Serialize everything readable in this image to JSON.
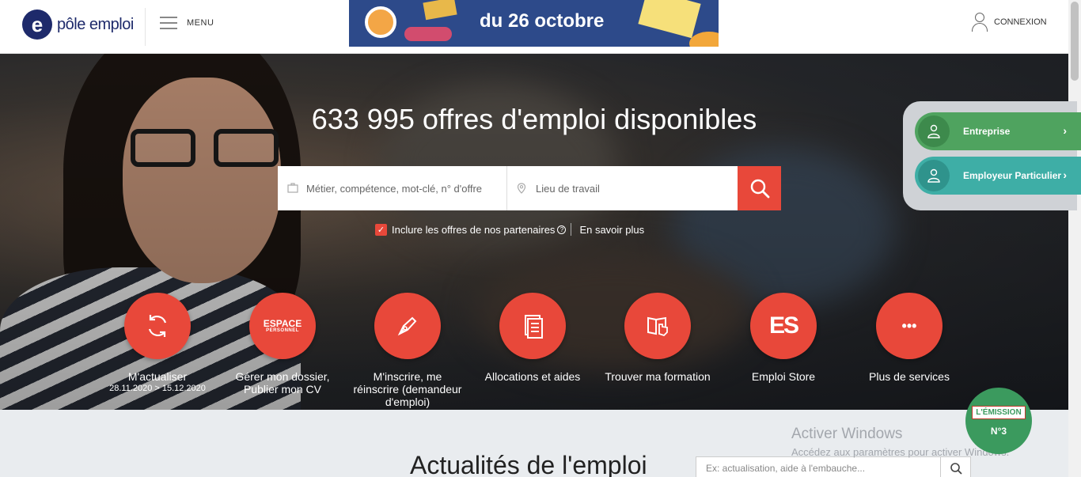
{
  "header": {
    "logo_text": "pôle emploi",
    "logo_mark": "e",
    "menu_label": "MENU",
    "banner_text": "du 26 octobre",
    "connexion_label": "CONNEXION"
  },
  "hero": {
    "title": "633 995 offres d'emploi disponibles",
    "search": {
      "job_placeholder": "Métier, compétence, mot-clé, n° d'offre",
      "location_placeholder": "Lieu de travail"
    },
    "partners_checkbox": {
      "label": "Inclure les offres de nos partenaires",
      "checked": true
    },
    "learn_more": "En savoir plus"
  },
  "services": [
    {
      "label": "M'actualiser",
      "sub": "28.11.2020 > 15.12.2020",
      "icon": "refresh-icon"
    },
    {
      "label": "Gérer mon dossier, Publier mon CV",
      "sub": "",
      "icon": "espace-personnel-icon",
      "icon_text_big": "ESPACE",
      "icon_text_small": "PERSONNEL"
    },
    {
      "label": "M'inscrire, me réinscrire (demandeur d'emploi)",
      "sub": "",
      "icon": "pen-icon"
    },
    {
      "label": "Allocations et aides",
      "sub": "",
      "icon": "document-icon"
    },
    {
      "label": "Trouver ma formation",
      "sub": "",
      "icon": "book-hand-icon"
    },
    {
      "label": "Emploi Store",
      "sub": "",
      "icon": "emploi-store-icon",
      "icon_text": "ES"
    },
    {
      "label": "Plus de services",
      "sub": "",
      "icon": "more-icon",
      "icon_text": "•••"
    }
  ],
  "side_panel": {
    "items": [
      {
        "label": "Entreprise",
        "color": "#4fa35f"
      },
      {
        "label": "Employeur Particulier",
        "color": "#3eaea6"
      }
    ]
  },
  "news": {
    "title": "Actualités de l'emploi",
    "search_placeholder": "Ex: actualisation, aide à l'embauche..."
  },
  "windows_watermark": {
    "line1": "Activer Windows",
    "line2": "Accédez aux paramètres pour activer Windows."
  },
  "emission_badge": {
    "label": "L'ÉMISSION",
    "number": "N°3"
  },
  "colors": {
    "accent": "#e8483a",
    "brand": "#1e2a6b",
    "green": "#4fa35f",
    "teal": "#3eaea6"
  }
}
